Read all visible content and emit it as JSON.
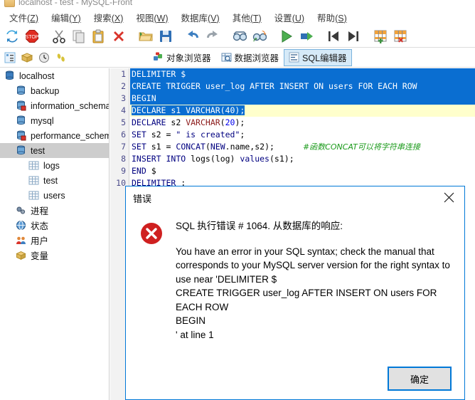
{
  "window": {
    "title": "localhost - test - MySQL-Front"
  },
  "menu": [
    {
      "label": "文件",
      "accel": "(Z)"
    },
    {
      "label": "编辑",
      "accel": "(Y)"
    },
    {
      "label": "搜索",
      "accel": "(X)"
    },
    {
      "label": "视图",
      "accel": "(W)"
    },
    {
      "label": "数据库",
      "accel": "(V)"
    },
    {
      "label": "其他",
      "accel": "(T)"
    },
    {
      "label": "设置",
      "accel": "(U)"
    },
    {
      "label": "帮助",
      "accel": "(S)"
    }
  ],
  "toolbar": {
    "buttons": [
      {
        "name": "refresh-icon"
      },
      {
        "name": "stop-icon"
      },
      {
        "name": "cut-icon"
      },
      {
        "name": "copy-icon"
      },
      {
        "name": "paste-icon"
      },
      {
        "name": "delete-icon"
      },
      {
        "name": "open-folder-icon"
      },
      {
        "name": "save-icon"
      },
      {
        "name": "undo-icon"
      },
      {
        "name": "redo-icon"
      },
      {
        "name": "find-icon"
      },
      {
        "name": "find-replace-icon"
      },
      {
        "name": "execute-icon"
      },
      {
        "name": "execute-step-icon"
      },
      {
        "name": "first-record-icon"
      },
      {
        "name": "last-record-icon"
      },
      {
        "name": "add-record-icon"
      },
      {
        "name": "delete-record-icon"
      }
    ]
  },
  "toolbar2": {
    "small_buttons": [
      {
        "name": "tree-view-icon"
      },
      {
        "name": "package-icon"
      },
      {
        "name": "history-clock-icon"
      },
      {
        "name": "footsteps-icon"
      }
    ],
    "view_tabs": [
      {
        "label": "对象浏览器",
        "icon": "object-browser-icon",
        "active": false
      },
      {
        "label": "数据浏览器",
        "icon": "data-browser-icon",
        "active": false
      },
      {
        "label": "SQL编辑器",
        "icon": "sql-editor-icon",
        "active": true
      }
    ]
  },
  "sidebar": {
    "items": [
      {
        "label": "localhost",
        "icon": "server-icon",
        "depth": 1,
        "selected": false
      },
      {
        "label": "backup",
        "icon": "database-icon",
        "depth": 2,
        "selected": false
      },
      {
        "label": "information_schema",
        "icon": "system-db-icon",
        "depth": 2,
        "selected": false
      },
      {
        "label": "mysql",
        "icon": "database-icon",
        "depth": 2,
        "selected": false
      },
      {
        "label": "performance_schema",
        "icon": "system-db-icon",
        "depth": 2,
        "selected": false
      },
      {
        "label": "test",
        "icon": "database-icon",
        "depth": 2,
        "selected": true
      },
      {
        "label": "logs",
        "icon": "table-icon",
        "depth": 3,
        "selected": false
      },
      {
        "label": "test",
        "icon": "table-icon",
        "depth": 3,
        "selected": false
      },
      {
        "label": "users",
        "icon": "table-icon",
        "depth": 3,
        "selected": false
      },
      {
        "label": "进程",
        "icon": "process-icon",
        "depth": 2,
        "selected": false
      },
      {
        "label": "状态",
        "icon": "status-icon",
        "depth": 2,
        "selected": false
      },
      {
        "label": "用户",
        "icon": "users-icon",
        "depth": 2,
        "selected": false
      },
      {
        "label": "变量",
        "icon": "variables-icon",
        "depth": 2,
        "selected": false
      }
    ]
  },
  "editor": {
    "lines": [
      {
        "n": "1",
        "text": "DELIMITER $",
        "state": "selected"
      },
      {
        "n": "2",
        "text": "CREATE TRIGGER user_log AFTER INSERT ON users FOR EACH ROW",
        "state": "selected"
      },
      {
        "n": "3",
        "text": "BEGIN",
        "state": "selected"
      },
      {
        "n": "4",
        "text": "DECLARE s1 VARCHAR(40);",
        "state": "current-selected"
      },
      {
        "n": "5",
        "text": "DECLARE s2 VARCHAR(20);",
        "state": "normal"
      },
      {
        "n": "6",
        "text": "SET s2 = \" is created\";",
        "state": "normal"
      },
      {
        "n": "7",
        "text": "SET s1 = CONCAT(NEW.name,s2);",
        "state": "normal",
        "comment": "#函数CONCAT可以将字符串连接"
      },
      {
        "n": "8",
        "text": "INSERT INTO logs(log) values(s1);",
        "state": "normal"
      },
      {
        "n": "9",
        "text": "END $",
        "state": "normal"
      },
      {
        "n": "10",
        "text": "DELIMITER ;",
        "state": "normal"
      }
    ]
  },
  "dialog": {
    "title": "错误",
    "close_label": "✕",
    "icon": "error-circle-icon",
    "heading": "SQL 执行错误 # 1064. 从数据库的响应:",
    "message": "You have an error in your SQL syntax; check the manual that corresponds to your MySQL server version for the right syntax to use near 'DELIMITER $\nCREATE TRIGGER user_log AFTER INSERT ON users FOR EACH ROW\nBEGIN\n' at line 1",
    "ok_label": "确定"
  },
  "colors": {
    "accent": "#0078d7",
    "selection": "#0a6ed1",
    "current_line": "#ffffcc",
    "error": "#d42020",
    "keyword": "#000080",
    "comment": "#1a9a1a"
  }
}
